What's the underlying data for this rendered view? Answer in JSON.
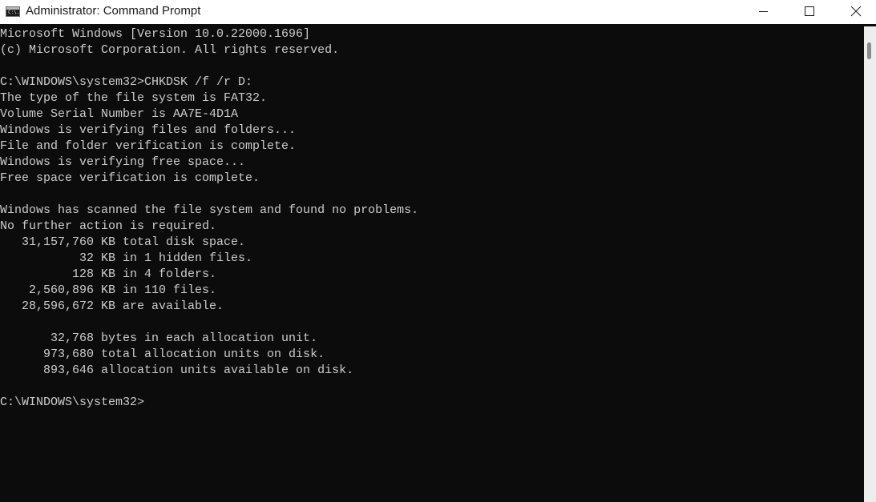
{
  "window": {
    "title": "Administrator: Command Prompt",
    "app_icon": "C:\\.",
    "controls": {
      "minimize_icon": "minimize-icon",
      "maximize_icon": "maximize-icon",
      "close_icon": "close-icon"
    }
  },
  "console": {
    "lines": [
      "Microsoft Windows [Version 10.0.22000.1696]",
      "(c) Microsoft Corporation. All rights reserved.",
      "",
      "C:\\WINDOWS\\system32>CHKDSK /f /r D:",
      "The type of the file system is FAT32.",
      "Volume Serial Number is AA7E-4D1A",
      "Windows is verifying files and folders...",
      "File and folder verification is complete.",
      "Windows is verifying free space...",
      "Free space verification is complete.",
      "",
      "Windows has scanned the file system and found no problems.",
      "No further action is required.",
      "   31,157,760 KB total disk space.",
      "           32 KB in 1 hidden files.",
      "          128 KB in 4 folders.",
      "    2,560,896 KB in 110 files.",
      "   28,596,672 KB are available.",
      "",
      "       32,768 bytes in each allocation unit.",
      "      973,680 total allocation units on disk.",
      "      893,646 allocation units available on disk.",
      "",
      "C:\\WINDOWS\\system32>"
    ]
  },
  "colors": {
    "console_bg": "#0c0c0c",
    "console_text": "#cccccc",
    "titlebar_bg": "#ffffff"
  }
}
